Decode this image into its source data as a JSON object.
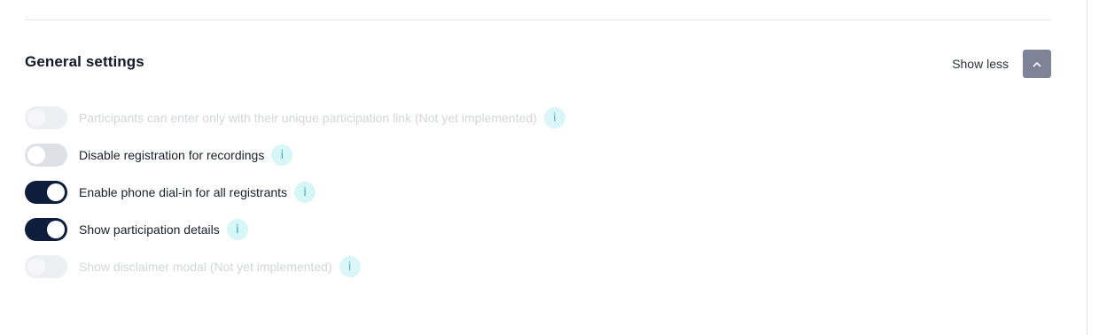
{
  "section": {
    "title": "General settings",
    "toggle_label": "Show less"
  },
  "icons": {
    "collapse": "chevron-up-icon",
    "info": "info-icon",
    "info_glyph": "i"
  },
  "colors": {
    "toggle_on": "#0f1d3d",
    "toggle_off": "#dfe0e6",
    "toggle_disabled": "#eeeff2",
    "info_bg": "#d6f6f8",
    "info_fg": "#2fa6b4",
    "collapse_button": "#7f8398"
  },
  "settings": [
    {
      "label": "Participants can enter only with their unique participation link (Not yet implemented)",
      "state": "off",
      "disabled": true
    },
    {
      "label": "Disable registration for recordings",
      "state": "off",
      "disabled": false
    },
    {
      "label": "Enable phone dial-in for all registrants",
      "state": "on",
      "disabled": false
    },
    {
      "label": "Show participation details",
      "state": "on",
      "disabled": false
    },
    {
      "label": "Show disclaimer modal (Not yet implemented)",
      "state": "off",
      "disabled": true
    }
  ]
}
